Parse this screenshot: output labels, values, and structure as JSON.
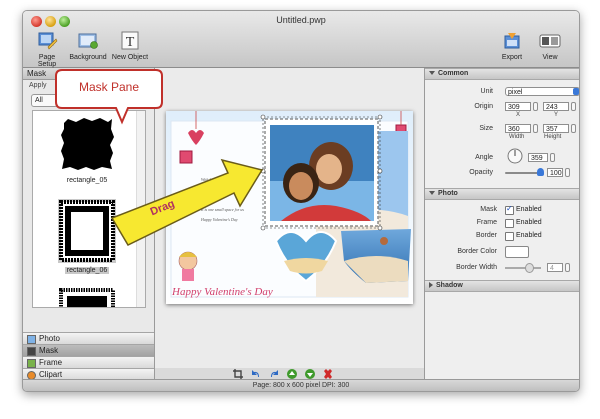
{
  "window": {
    "title": "Untitled.pwp"
  },
  "toolbar": {
    "items": [
      {
        "label": "Page Setup"
      },
      {
        "label": "Background"
      },
      {
        "label": "New Object"
      }
    ],
    "right": [
      {
        "label": "Export"
      },
      {
        "label": "View"
      }
    ]
  },
  "sidebar": {
    "header": "Mask",
    "apply_label": "Apply",
    "filter_value": "All",
    "masks": [
      {
        "name": "rectangle_05"
      },
      {
        "name": "rectangle_06"
      }
    ],
    "tabs": [
      {
        "label": "Photo"
      },
      {
        "label": "Mask"
      },
      {
        "label": "Frame"
      },
      {
        "label": "Clipart"
      }
    ]
  },
  "canvas": {
    "card_caption": "Happy Valentine's Day"
  },
  "status": {
    "text": "Page: 800 x 600 pixel DPI: 300"
  },
  "inspector": {
    "common": {
      "header": "Common",
      "unit_label": "Unit",
      "unit_value": "pixel",
      "origin_label": "Origin",
      "origin_x": "309",
      "origin_y": "243",
      "x_sub": "X",
      "y_sub": "Y",
      "size_label": "Size",
      "width": "360",
      "height": "357",
      "width_sub": "Width",
      "height_sub": "Height",
      "angle_label": "Angle",
      "angle_value": "359",
      "opacity_label": "Opacity",
      "opacity_value": "100"
    },
    "photo": {
      "header": "Photo",
      "mask_label": "Mask",
      "frame_label": "Frame",
      "border_label": "Border",
      "enabled_text": "Enabled",
      "mask_enabled": true,
      "frame_enabled": false,
      "border_enabled": false,
      "border_color_label": "Border Color",
      "border_width_label": "Border Width",
      "border_width_value": "4"
    },
    "shadow": {
      "header": "Shadow"
    }
  },
  "annotations": {
    "callout": "Mask Pane",
    "arrow_label": "Drag"
  }
}
